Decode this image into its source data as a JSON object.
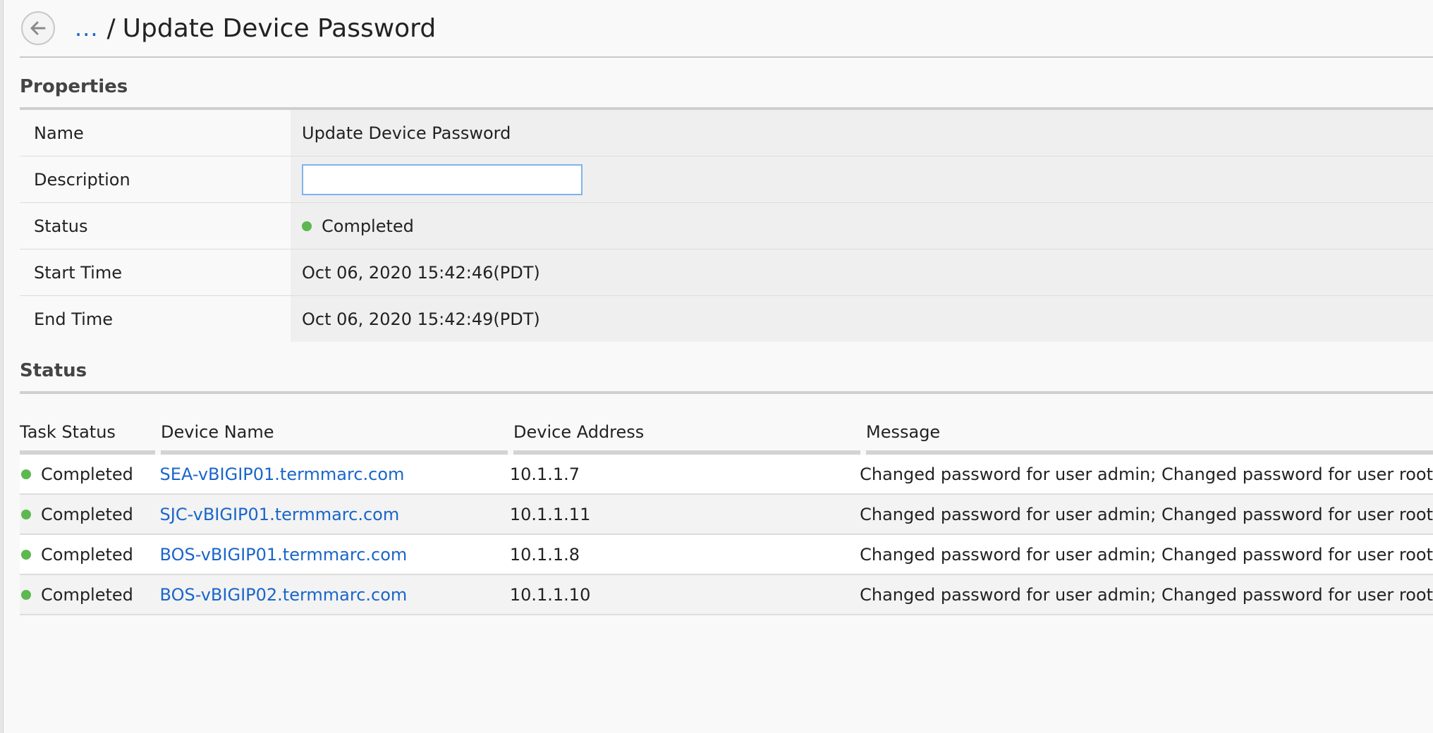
{
  "header": {
    "breadcrumb_ellipsis": "...",
    "separator": "/",
    "title": "Update Device Password"
  },
  "properties": {
    "section_title": "Properties",
    "rows": {
      "name": {
        "label": "Name",
        "value": "Update Device Password"
      },
      "description": {
        "label": "Description",
        "value": "",
        "placeholder": ""
      },
      "status": {
        "label": "Status",
        "value": "Completed"
      },
      "start_time": {
        "label": "Start Time",
        "value": "Oct 06, 2020 15:42:46(PDT)"
      },
      "end_time": {
        "label": "End Time",
        "value": "Oct 06, 2020 15:42:49(PDT)"
      }
    }
  },
  "status": {
    "section_title": "Status",
    "columns": [
      "Task Status",
      "Device Name",
      "Device Address",
      "Message"
    ],
    "rows": [
      {
        "task_status": "Completed",
        "device_name": "SEA-vBIGIP01.termmarc.com",
        "device_address": "10.1.1.7",
        "message": "Changed password for user admin; Changed password for user root"
      },
      {
        "task_status": "Completed",
        "device_name": "SJC-vBIGIP01.termmarc.com",
        "device_address": "10.1.1.11",
        "message": "Changed password for user admin; Changed password for user root"
      },
      {
        "task_status": "Completed",
        "device_name": "BOS-vBIGIP01.termmarc.com",
        "device_address": "10.1.1.8",
        "message": "Changed password for user admin; Changed password for user root"
      },
      {
        "task_status": "Completed",
        "device_name": "BOS-vBIGIP02.termmarc.com",
        "device_address": "10.1.1.10",
        "message": "Changed password for user admin; Changed password for user root"
      }
    ]
  },
  "colors": {
    "status_completed": "#5cb84f",
    "link": "#1a66c9"
  },
  "icons": {
    "back": "arrow-left-icon",
    "status": "status-dot-icon"
  }
}
